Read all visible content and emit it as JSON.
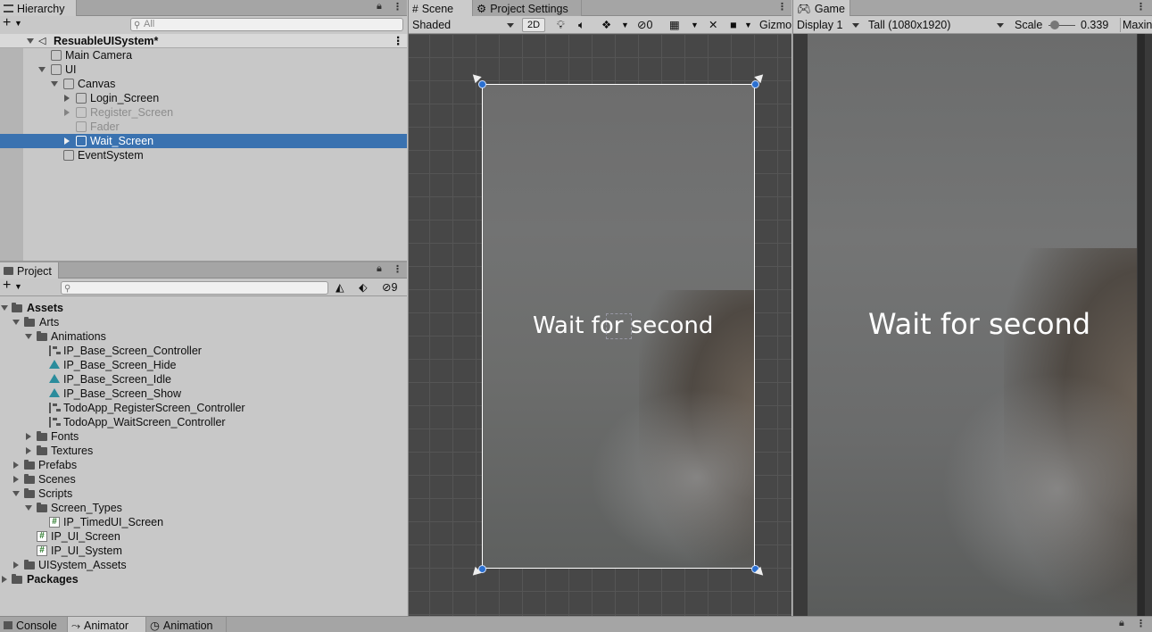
{
  "hierarchy": {
    "tab": "Hierarchy",
    "search_placeholder": "All",
    "scene_name": "ResuableUISystem*",
    "items": [
      {
        "label": "Main Camera"
      },
      {
        "label": "UI"
      },
      {
        "label": "Canvas"
      },
      {
        "label": "Login_Screen"
      },
      {
        "label": "Register_Screen"
      },
      {
        "label": "Fader"
      },
      {
        "label": "Wait_Screen"
      },
      {
        "label": "EventSystem"
      }
    ]
  },
  "project": {
    "tab": "Project",
    "hidden_count": "9",
    "items": [
      {
        "label": "Assets"
      },
      {
        "label": "Arts"
      },
      {
        "label": "Animations"
      },
      {
        "label": "IP_Base_Screen_Controller"
      },
      {
        "label": "IP_Base_Screen_Hide"
      },
      {
        "label": "IP_Base_Screen_Idle"
      },
      {
        "label": "IP_Base_Screen_Show"
      },
      {
        "label": "TodoApp_RegisterScreen_Controller"
      },
      {
        "label": "TodoApp_WaitScreen_Controller"
      },
      {
        "label": "Fonts"
      },
      {
        "label": "Textures"
      },
      {
        "label": "Prefabs"
      },
      {
        "label": "Scenes"
      },
      {
        "label": "Scripts"
      },
      {
        "label": "Screen_Types"
      },
      {
        "label": "IP_TimedUI_Screen"
      },
      {
        "label": "IP_UI_Screen"
      },
      {
        "label": "IP_UI_System"
      },
      {
        "label": "UISystem_Assets"
      },
      {
        "label": "Packages"
      }
    ]
  },
  "scene": {
    "tab": "Scene",
    "tab2": "Project Settings",
    "draw_mode": "Shaded",
    "mode_2d": "2D",
    "hidden_count": "0",
    "gizmos": "Gizmo",
    "text": "Wait for second"
  },
  "game": {
    "tab": "Game",
    "display": "Display 1",
    "resolution": "Tall (1080x1920)",
    "scale_label": "Scale",
    "scale_value": "0.339",
    "maximize": "Maxin",
    "text": "Wait for second"
  },
  "bottom": {
    "tabs": [
      {
        "label": "Console"
      },
      {
        "label": "Animator"
      },
      {
        "label": "Animation"
      }
    ]
  }
}
